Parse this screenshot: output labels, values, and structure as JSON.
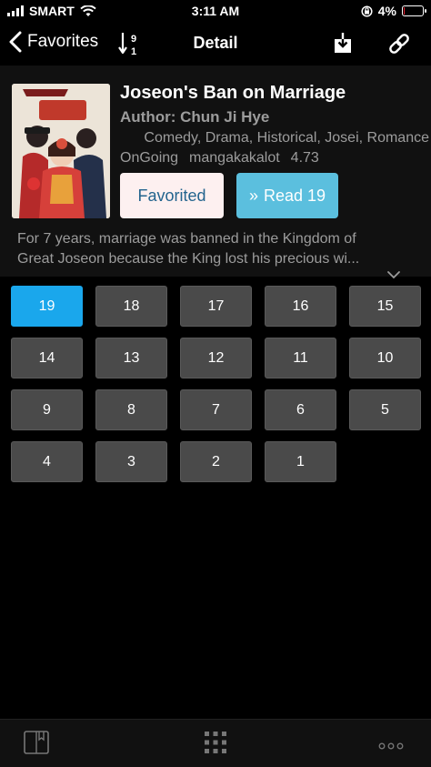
{
  "status": {
    "carrier": "SMART",
    "time": "3:11 AM",
    "battery_text": "4%",
    "battery_level": 0.04
  },
  "nav": {
    "back_label": "Favorites",
    "title": "Detail",
    "sort_top": "9",
    "sort_bottom": "1"
  },
  "manga": {
    "title": "Joseon's Ban on Marriage",
    "author": "Author: Chun Ji Hye",
    "genres": "Comedy, Drama, Historical, Josei, Romance",
    "status": "OnGoing",
    "source": "mangakakalot",
    "rating": "4.73",
    "description_line1": "For 7 years, marriage was banned in the Kingdom of",
    "description_line2": "Great Joseon because the King lost his precious wi..."
  },
  "buttons": {
    "favorited": "Favorited",
    "read_label": "Read 19"
  },
  "chapters": [
    "19",
    "18",
    "17",
    "16",
    "15",
    "14",
    "13",
    "12",
    "11",
    "10",
    "9",
    "8",
    "7",
    "6",
    "5",
    "4",
    "3",
    "2",
    "1"
  ],
  "active_chapter": "19",
  "colors": {
    "accent": "#1aa7ec",
    "read_button": "#5bbfde",
    "chip": "#4a4a4a",
    "favorited_text": "#23648e"
  }
}
